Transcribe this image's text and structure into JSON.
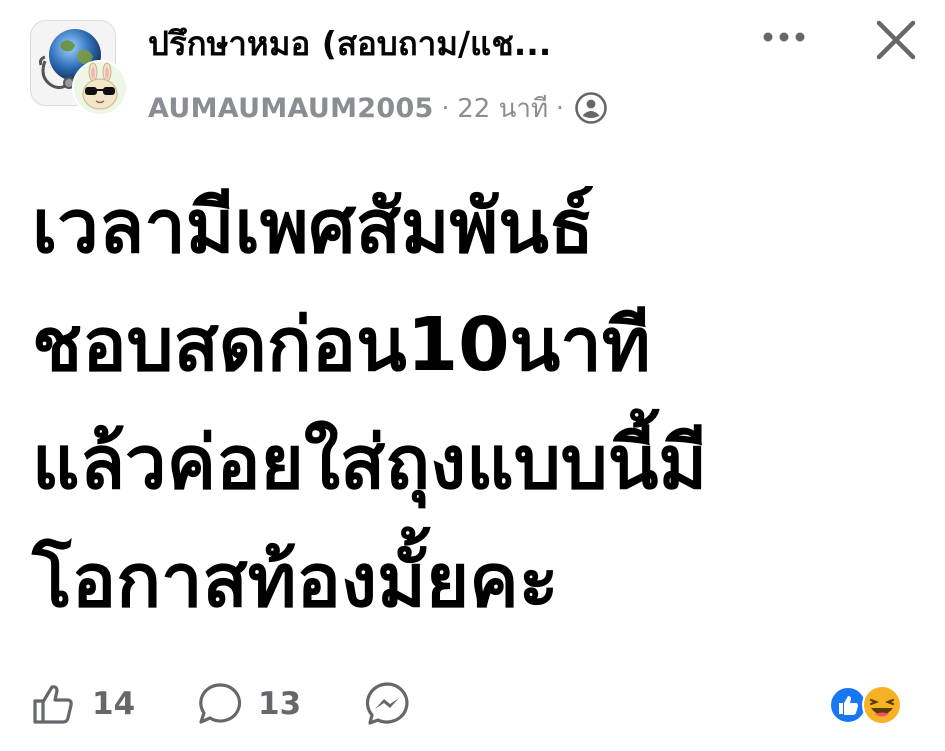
{
  "header": {
    "group_name": "ปรึกษาหมอ (สอบถาม/แช...",
    "author": "AUMAUMAUM2005",
    "separator": "·",
    "time": "22 นาที",
    "group_avatar_icon": "globe-stethoscope-icon",
    "user_avatar_icon": "bunny-sunglasses-icon",
    "privacy_icon": "members-privacy-icon",
    "more_icon": "more-dots-icon",
    "close_icon": "close-icon"
  },
  "post": {
    "text": "เวลามีเพศสัมพันธ์\nชอบสดก่อน10นาที\nแล้วค่อยใส่ถุงแบบนี้มี\nโอกาสท้องมั้ยคะ"
  },
  "footer": {
    "like_count": "14",
    "comment_count": "13",
    "like_icon": "thumbs-up-icon",
    "comment_icon": "comment-bubble-icon",
    "share_icon": "messenger-icon",
    "reactions": [
      "like-reaction-icon",
      "haha-reaction-icon"
    ]
  },
  "colors": {
    "muted": "#8a8d91",
    "icon": "#65676b",
    "like_blue": "#1877f2",
    "haha_yellow": "#f7b125"
  }
}
